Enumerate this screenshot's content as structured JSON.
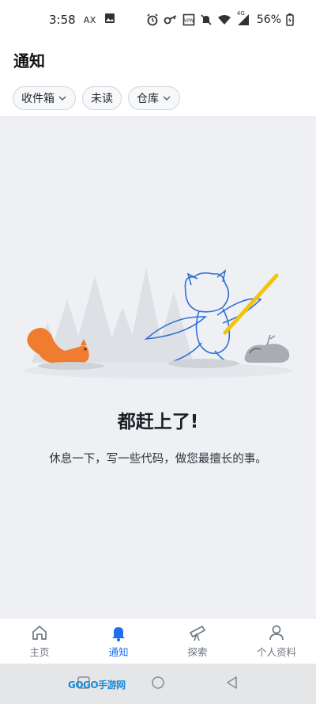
{
  "status_bar": {
    "time": "3:58",
    "carrier_label": "AX",
    "network_label": "4G",
    "battery": "56%"
  },
  "header": {
    "title": "通知"
  },
  "filters": [
    {
      "label": "收件箱",
      "has_dropdown": true
    },
    {
      "label": "未读",
      "has_dropdown": false
    },
    {
      "label": "仓库",
      "has_dropdown": true
    }
  ],
  "empty_state": {
    "title": "都赶上了!",
    "description": "休息一下，写一些代码，做您最擅长的事。"
  },
  "bottom_nav": [
    {
      "label": "主页",
      "icon": "home-icon",
      "active": false
    },
    {
      "label": "通知",
      "icon": "bell-icon",
      "active": true
    },
    {
      "label": "探索",
      "icon": "telescope-icon",
      "active": false
    },
    {
      "label": "个人资料",
      "icon": "person-icon",
      "active": false
    }
  ],
  "watermark": "GOGO手游网",
  "colors": {
    "accent": "#1f6feb",
    "background": "#eef0f4",
    "squirrel": "#f07c2f",
    "stick": "#f2c40f",
    "octocat_line": "#2f6fd6"
  }
}
